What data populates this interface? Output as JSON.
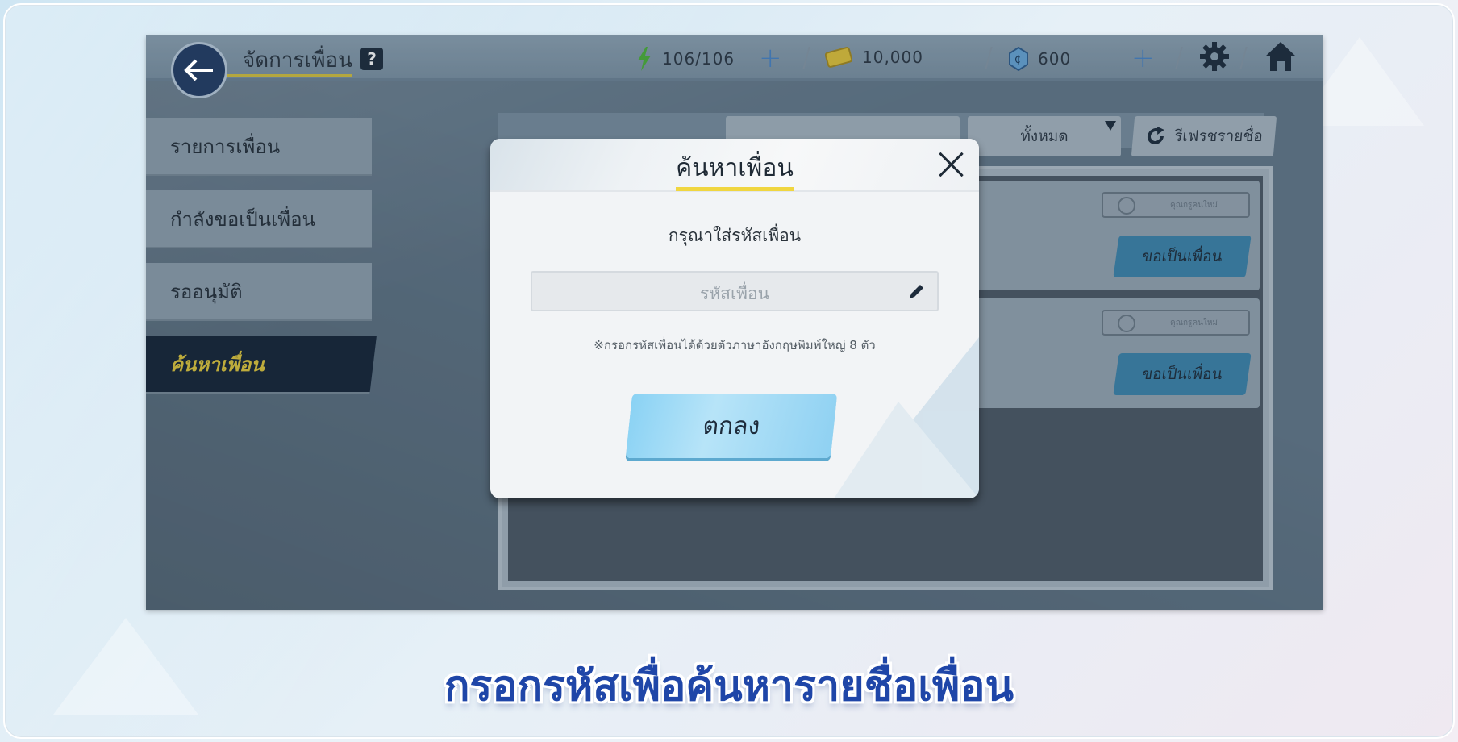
{
  "header": {
    "title": "จัดการเพื่อน",
    "help_label": "?",
    "stamina": "106/106",
    "gold": "10,000",
    "gems": "600",
    "plus": "+"
  },
  "menu": {
    "items": [
      {
        "label": "รายการเพื่อน"
      },
      {
        "label": "กำลังขอเป็นเพื่อน"
      },
      {
        "label": "รออนุมัติ"
      },
      {
        "label": "ค้นหาเพื่อน"
      }
    ]
  },
  "panel": {
    "filter_label": "ทั้งหมด",
    "refresh_label": "รีเฟรชรายชื่อ",
    "new_player_badge": "คุณกรูคนใหม่",
    "request_label": "ขอเป็นเพื่อน"
  },
  "modal": {
    "title": "ค้นหาเพื่อน",
    "prompt": "กรุณาใส่รหัสเพื่อน",
    "input_placeholder": "รหัสเพื่อน",
    "hint": "※กรอกรหัสเพื่อนได้ด้วยตัวภาษาอังกฤษพิมพ์ใหญ่ 8 ตัว",
    "ok_label": "ตกลง"
  },
  "caption": "กรอกรหัสเพื่อค้นหารายชื่อเพื่อน",
  "colors": {
    "accent_yellow": "#f0d640",
    "dark_navy": "#162538",
    "button_blue": "#8ad2f4",
    "caption_blue": "#1f46a8"
  }
}
